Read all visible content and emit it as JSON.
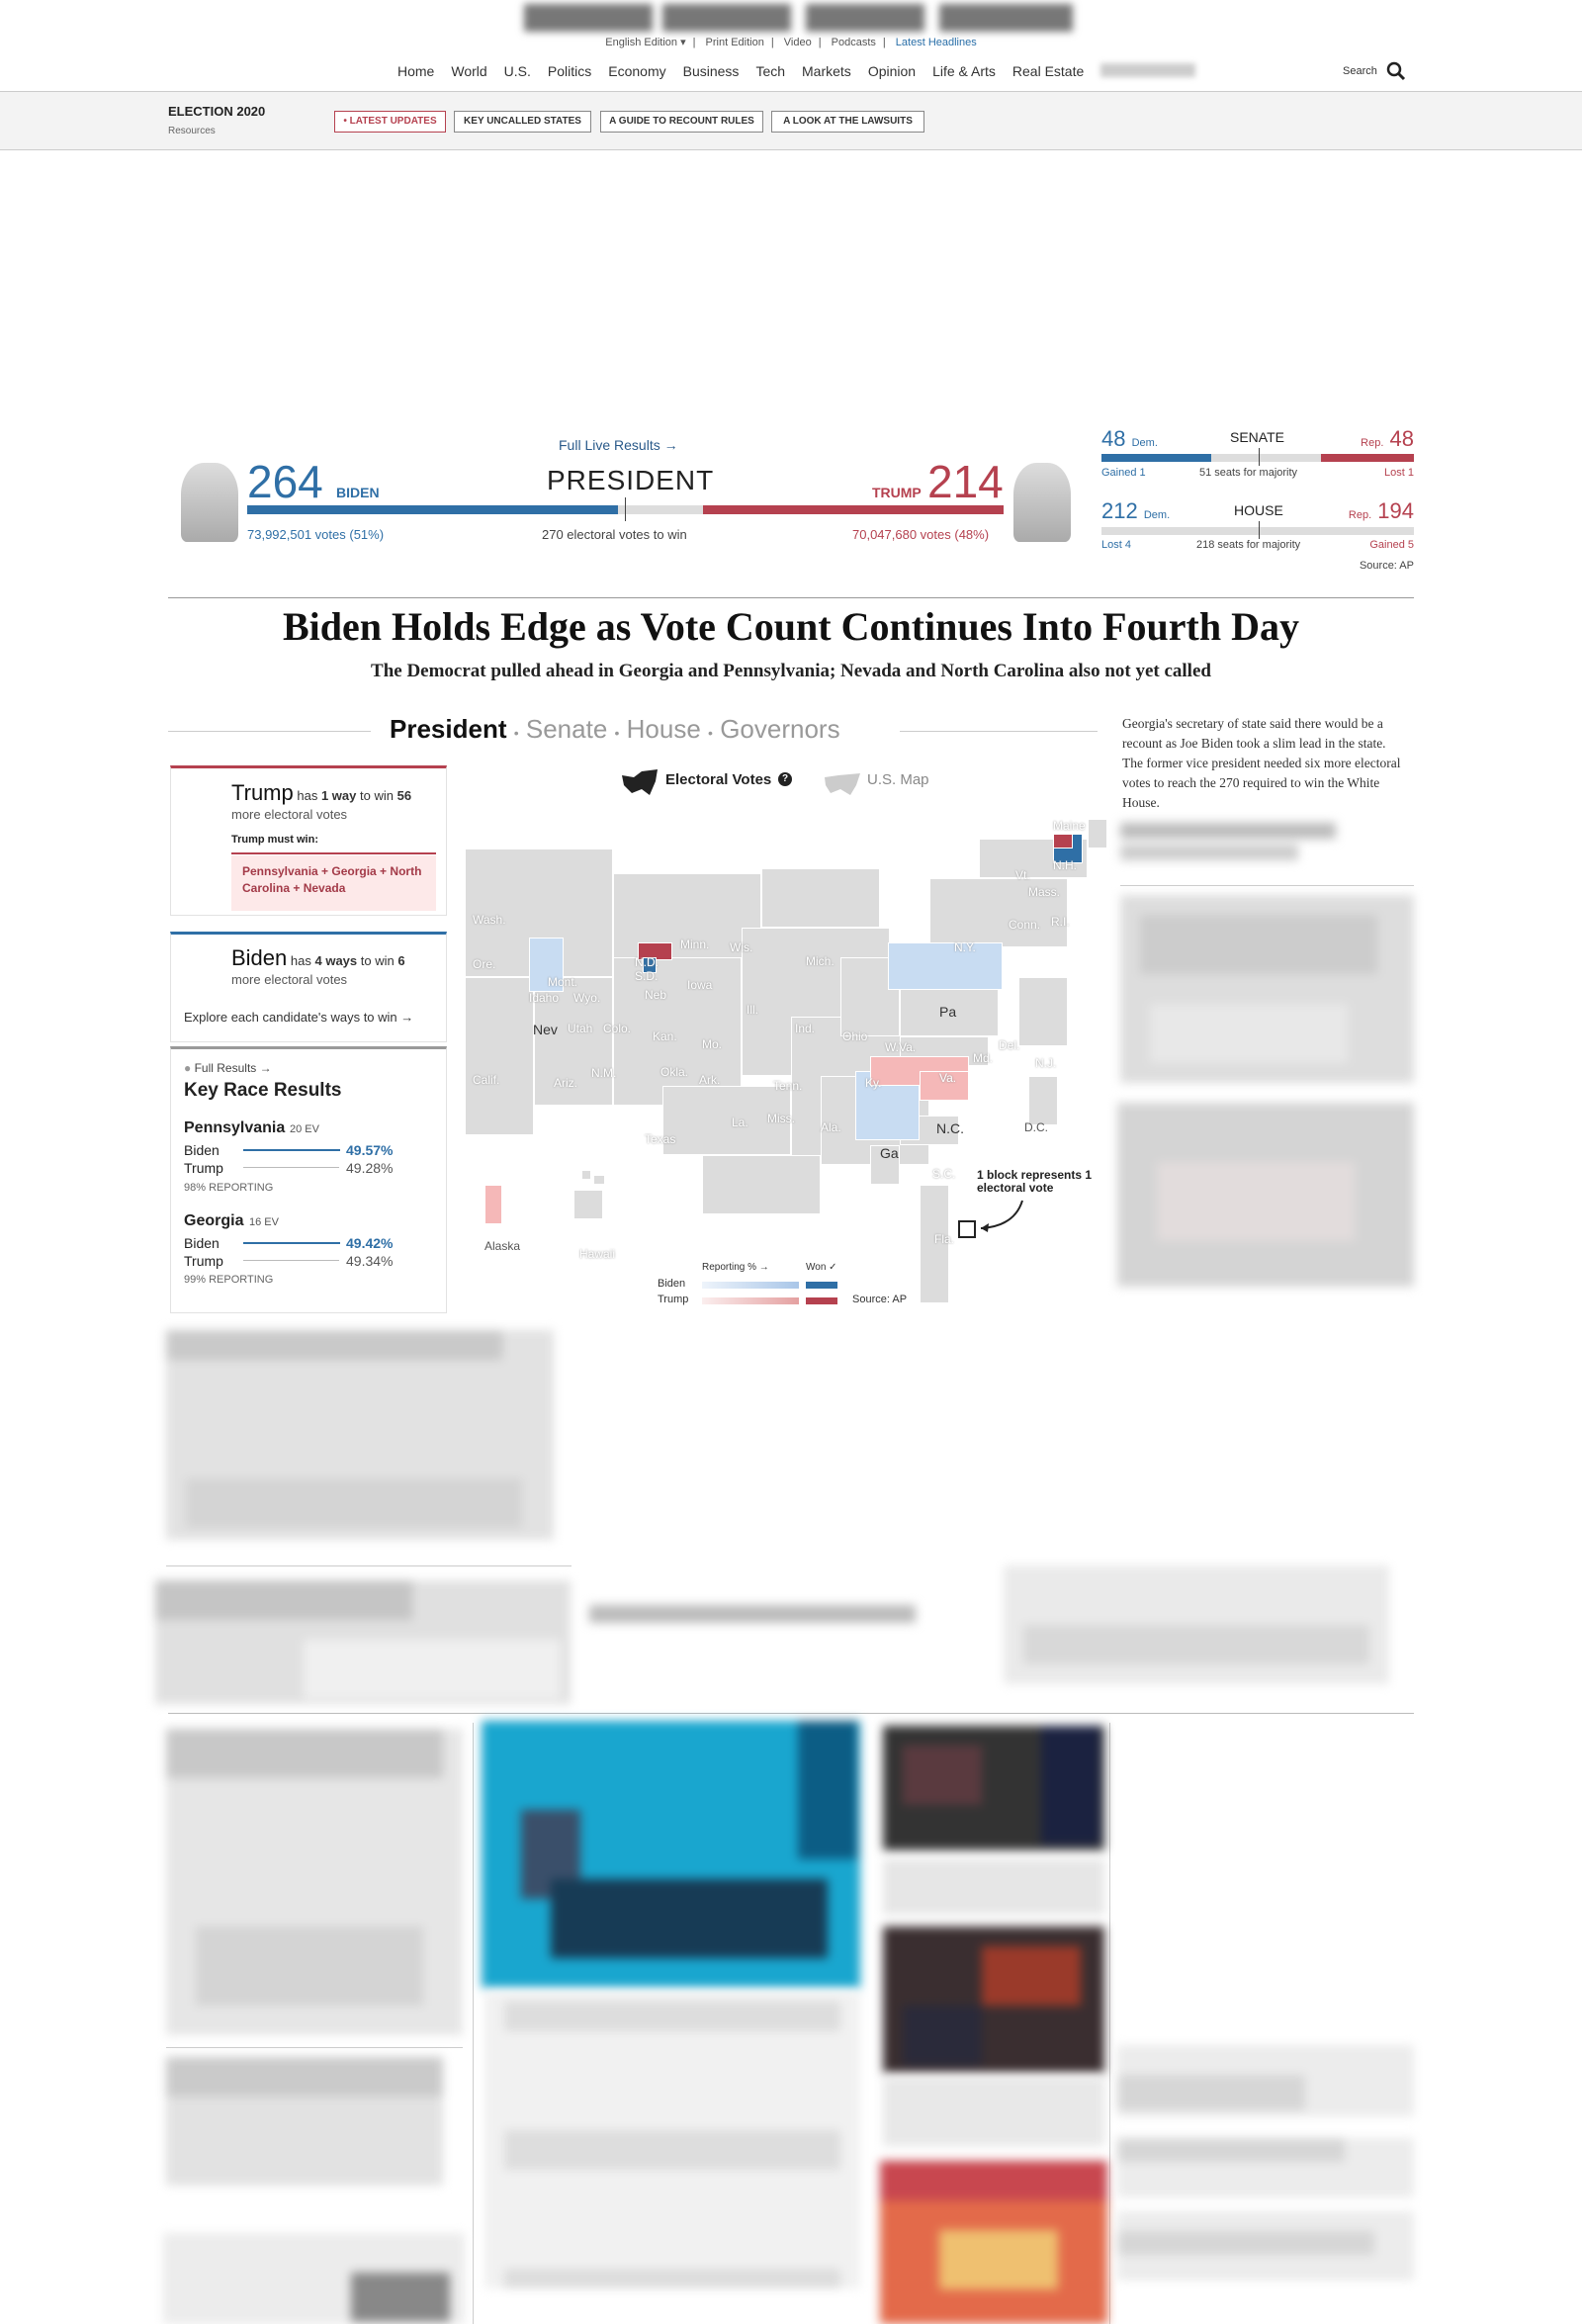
{
  "topbar": {
    "edition": "English Edition ▾",
    "print": "Print Edition",
    "video": "Video",
    "podcasts": "Podcasts",
    "latest": "Latest Headlines"
  },
  "nav": {
    "items": [
      "Home",
      "World",
      "U.S.",
      "Politics",
      "Economy",
      "Business",
      "Tech",
      "Markets",
      "Opinion",
      "Life & Arts",
      "Real Estate"
    ],
    "search": "Search"
  },
  "election": {
    "title": "ELECTION 2020",
    "sub": "Resources",
    "pills": [
      "• LATEST UPDATES",
      "KEY UNCALLED STATES",
      "A GUIDE TO RECOUNT RULES",
      "A LOOK AT THE LAWSUITS"
    ]
  },
  "president": {
    "link": "Full Live Results →",
    "title": "PRESIDENT",
    "needed": "270 electoral votes to win",
    "biden_ev": "264",
    "biden_name": "BIDEN",
    "biden_votes": "73,992,501 votes (51%)",
    "trump_ev": "214",
    "trump_name": "TRUMP",
    "trump_votes": "70,047,680 votes (48%)",
    "biden_share": 0.4907,
    "trump_share": 0.3978
  },
  "senate": {
    "title": "SENATE",
    "dem": "48",
    "dem_label": "Dem.",
    "rep": "48",
    "rep_label": "Rep.",
    "majority": "51 seats for majority",
    "dem_change": "Gained 1",
    "rep_change": "Lost 1"
  },
  "house": {
    "title": "HOUSE",
    "dem": "212",
    "dem_label": "Dem.",
    "rep": "194",
    "rep_label": "Rep.",
    "majority": "218 seats for majority",
    "dem_change": "Lost 4",
    "rep_change": "Gained 5"
  },
  "source": "Source: AP",
  "headline": "Biden Holds Edge as Vote Count Continues Into Fourth Day",
  "dek": "The Democrat pulled ahead in Georgia and Pennsylvania; Nevada and North Carolina also not yet called",
  "tabs": {
    "president": "President",
    "senate": "Senate",
    "house": "House",
    "governors": "Governors",
    "sep": "•"
  },
  "sidebar_text": "Georgia's secretary of state said there would be a recount as Joe Biden took a slim lead in the state. The former vice president needed six more electoral votes to reach the 270 required to win the White House.",
  "paths": {
    "trump_name": "Trump",
    "trump_text_a": "has",
    "trump_ways": "1 way",
    "trump_text_b": "to win",
    "trump_num": "56",
    "trump_more": "more electoral votes",
    "trump_must": "Trump must win:",
    "trump_states": "Pennsylvania + Georgia + North Carolina + Nevada",
    "biden_name": "Biden",
    "biden_text_a": "has",
    "biden_ways": "4 ways",
    "biden_text_b": "to win",
    "biden_num": "6",
    "biden_more": "more electoral votes",
    "explore": "Explore each candidate's ways to win →"
  },
  "key_races": {
    "link": "Full Results →",
    "title": "Key Race Results",
    "races": [
      {
        "state": "Pennsylvania",
        "ev": "20 EV",
        "biden": "Biden",
        "biden_pct": "49.57%",
        "trump": "Trump",
        "trump_pct": "49.28%",
        "reporting": "98% REPORTING"
      },
      {
        "state": "Georgia",
        "ev": "16 EV",
        "biden": "Biden",
        "biden_pct": "49.42%",
        "trump": "Trump",
        "trump_pct": "49.34%",
        "reporting": "99% REPORTING"
      }
    ]
  },
  "map": {
    "toggle_ev": "Electoral Votes",
    "toggle_us": "U.S. Map",
    "note": "1 block represents 1 electoral vote",
    "legend_reporting": "Reporting % →",
    "legend_won": "Won ✓",
    "legend_biden": "Biden",
    "legend_trump": "Trump",
    "source": "Source: AP",
    "colors": {
      "biden_won": "#2f6fa6",
      "trump_won": "#b5414f",
      "biden_light": "#c8dcf2",
      "trump_light": "#f5b8b8",
      "uncalled": "#dcdcdc"
    },
    "labels": [
      "Maine",
      "Vt.",
      "N.H.",
      "Mass.",
      "Wash.",
      "N.Y.",
      "Conn.",
      "R.I.",
      "Minn.",
      "Wis.",
      "Mich.",
      "Ore.",
      "N.D.",
      "Mont.",
      "Idaho",
      "Wyo.",
      "S.D.",
      "Iowa",
      "Nev",
      "Utah",
      "Colo.",
      "Neb",
      "Kan.",
      "Ill.",
      "Pa",
      "Ind.",
      "Ohio",
      "W.Va.",
      "N.J.",
      "Del.",
      "Md.",
      "Mo.",
      "Calif.",
      "Ariz.",
      "N.M.",
      "Okla.",
      "Ark.",
      "Ky.",
      "Va.",
      "Tenn.",
      "N.C.",
      "D.C.",
      "Texas",
      "La.",
      "Miss.",
      "Ala.",
      "Ga",
      "S.C.",
      "Alaska",
      "Hawaii",
      "Fla."
    ]
  }
}
